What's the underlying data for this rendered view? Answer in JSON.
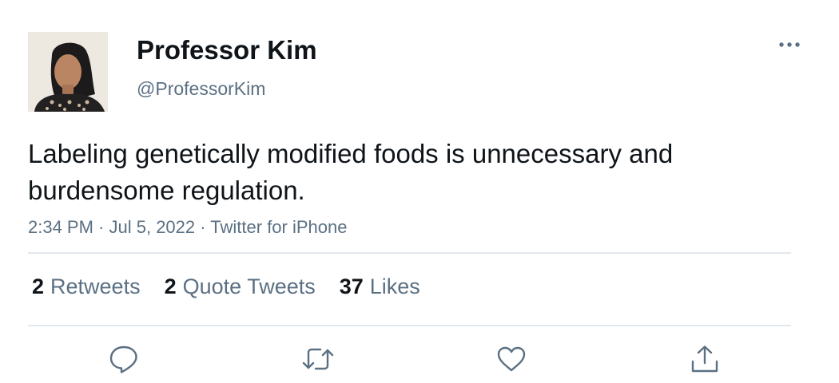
{
  "author": {
    "display_name": "Professor Kim",
    "handle": "@ProfessorKim"
  },
  "tweet": {
    "text": "Labeling genetically modified foods is unnecessary and burdensome regulation.",
    "time": "2:34 PM",
    "date": "Jul 5, 2022",
    "source": "Twitter for iPhone",
    "separator": " · "
  },
  "stats": {
    "retweets": {
      "count": "2",
      "label": "Retweets"
    },
    "quote_tweets": {
      "count": "2",
      "label": "Quote Tweets"
    },
    "likes": {
      "count": "37",
      "label": "Likes"
    }
  },
  "icons": {
    "more": "more-horizontal-icon",
    "reply": "reply-icon",
    "retweet": "retweet-icon",
    "like": "heart-icon",
    "share": "share-icon"
  },
  "colors": {
    "primary_text": "#0f1419",
    "secondary_text": "#5b7083",
    "divider": "#e1e8ed",
    "background": "#ffffff"
  }
}
